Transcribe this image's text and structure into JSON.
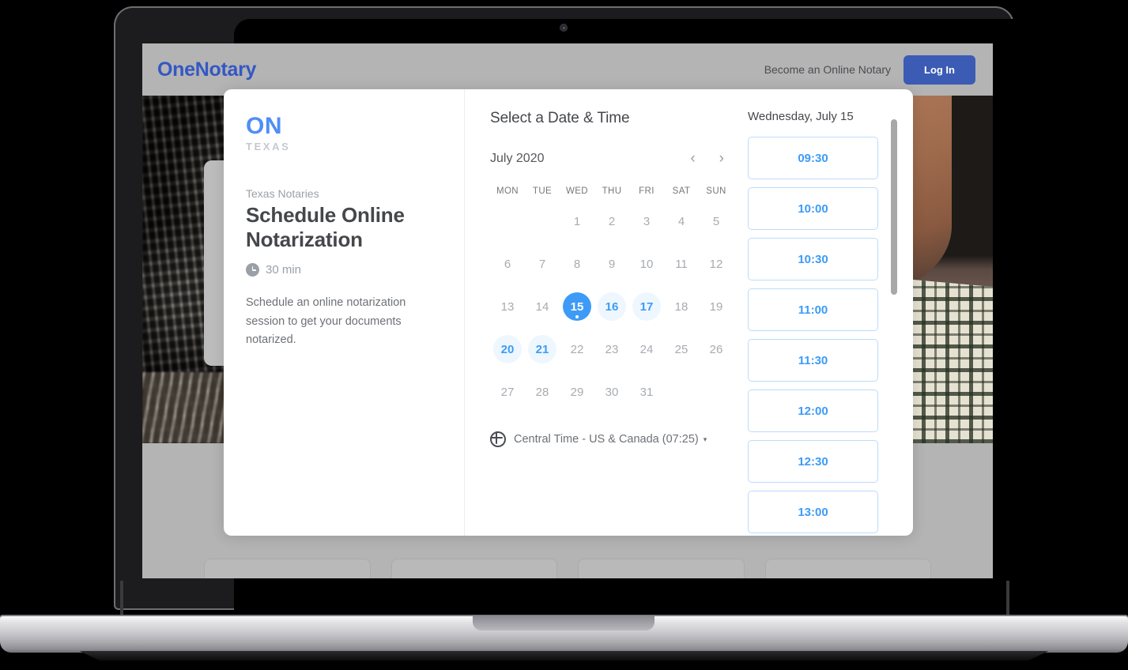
{
  "site": {
    "brand": "OneNotary",
    "become_notary_link": "Become an Online Notary",
    "login_button": "Log In",
    "header_bg": "#b4b4b4",
    "brand_color": "#3457c4",
    "login_color": "#3b5bb5"
  },
  "modal": {
    "left": {
      "logo_main": "ON",
      "logo_sub": "TEXAS",
      "organization": "Texas Notaries",
      "event_title": "Schedule Online Notarization",
      "duration": "30 min",
      "description": "Schedule an online notarization session to get your documents notarized."
    },
    "right": {
      "heading": "Select a Date & Time",
      "month_label": "July 2020",
      "prev_label": "‹",
      "next_label": "›",
      "day_headers": [
        "MON",
        "TUE",
        "WED",
        "THU",
        "FRI",
        "SAT",
        "SUN"
      ],
      "weeks": [
        [
          {
            "label": "",
            "state": "empty"
          },
          {
            "label": "",
            "state": "empty"
          },
          {
            "label": "1",
            "state": "disabled"
          },
          {
            "label": "2",
            "state": "disabled"
          },
          {
            "label": "3",
            "state": "disabled"
          },
          {
            "label": "4",
            "state": "disabled"
          },
          {
            "label": "5",
            "state": "disabled"
          }
        ],
        [
          {
            "label": "6",
            "state": "disabled"
          },
          {
            "label": "7",
            "state": "disabled"
          },
          {
            "label": "8",
            "state": "disabled"
          },
          {
            "label": "9",
            "state": "disabled"
          },
          {
            "label": "10",
            "state": "disabled"
          },
          {
            "label": "11",
            "state": "disabled"
          },
          {
            "label": "12",
            "state": "disabled"
          }
        ],
        [
          {
            "label": "13",
            "state": "disabled"
          },
          {
            "label": "14",
            "state": "disabled"
          },
          {
            "label": "15",
            "state": "selected"
          },
          {
            "label": "16",
            "state": "available"
          },
          {
            "label": "17",
            "state": "available"
          },
          {
            "label": "18",
            "state": "disabled"
          },
          {
            "label": "19",
            "state": "disabled"
          }
        ],
        [
          {
            "label": "20",
            "state": "available"
          },
          {
            "label": "21",
            "state": "available"
          },
          {
            "label": "22",
            "state": "disabled"
          },
          {
            "label": "23",
            "state": "disabled"
          },
          {
            "label": "24",
            "state": "disabled"
          },
          {
            "label": "25",
            "state": "disabled"
          },
          {
            "label": "26",
            "state": "disabled"
          }
        ],
        [
          {
            "label": "27",
            "state": "disabled"
          },
          {
            "label": "28",
            "state": "disabled"
          },
          {
            "label": "29",
            "state": "disabled"
          },
          {
            "label": "30",
            "state": "disabled"
          },
          {
            "label": "31",
            "state": "disabled"
          },
          {
            "label": "",
            "state": "empty"
          },
          {
            "label": "",
            "state": "empty"
          }
        ]
      ],
      "timezone": "Central Time - US & Canada (07:25)",
      "timezone_caret": "▾",
      "selected_date_label": "Wednesday, July 15",
      "time_slots": [
        "09:30",
        "10:00",
        "10:30",
        "11:00",
        "11:30",
        "12:00",
        "12:30",
        "13:00"
      ],
      "accent_color": "#3d9bf7",
      "available_bg": "#eef7fe"
    }
  }
}
